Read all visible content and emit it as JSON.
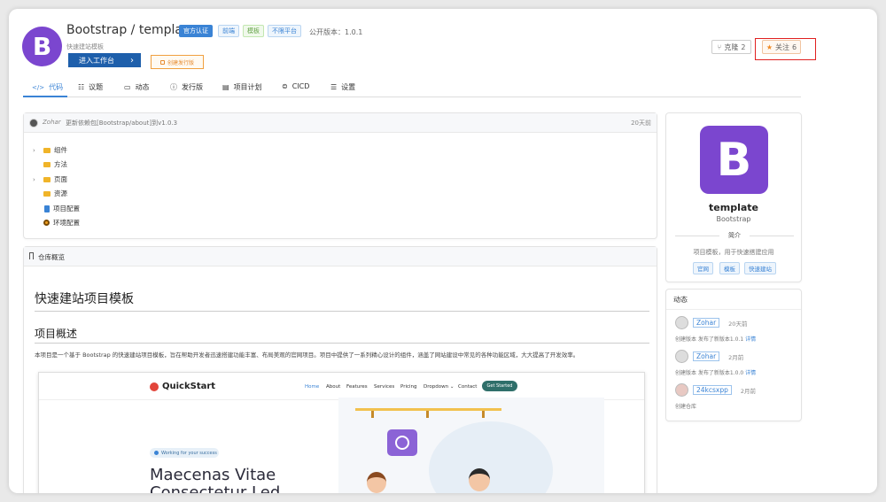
{
  "header": {
    "repo_title": "Bootstrap / template",
    "tags": [
      "官方认证",
      "前端",
      "模板",
      "不限平台"
    ],
    "version": "公开版本：1.0.1",
    "subtitle": "快速建站模板",
    "workbench_label": "进入工作台",
    "release_label": "创建发行版",
    "fork_label": "克隆",
    "fork_count": "2",
    "follow_label": "关注",
    "follow_count": "6",
    "logo_letter": "B"
  },
  "tabs": [
    {
      "label": "代码",
      "icon": "code-icon"
    },
    {
      "label": "议题",
      "icon": "issues-icon"
    },
    {
      "label": "动态",
      "icon": "activity-icon"
    },
    {
      "label": "发行版",
      "icon": "release-icon"
    },
    {
      "label": "项目计划",
      "icon": "plan-icon"
    },
    {
      "label": "CICD",
      "icon": "cicd-icon"
    },
    {
      "label": "设置",
      "icon": "settings-icon"
    }
  ],
  "commit": {
    "author": "Zohar",
    "message": "更新依赖包[Bootstrap/about]到v1.0.3",
    "time": "20天前"
  },
  "tree": [
    {
      "name": "组件",
      "type": "folder",
      "expandable": true
    },
    {
      "name": "方法",
      "type": "folder",
      "expandable": false
    },
    {
      "name": "页面",
      "type": "folder",
      "expandable": true
    },
    {
      "name": "资源",
      "type": "folder",
      "expandable": false
    },
    {
      "name": "项目配置",
      "type": "file",
      "expandable": false
    },
    {
      "name": "环境配置",
      "type": "config",
      "expandable": false
    }
  ],
  "readme": {
    "header": "仓库概览",
    "h1": "快速建站项目模板",
    "h2": "项目概述",
    "paragraph": "本项目是一个基于 Bootstrap 的快速建站项目模板，旨在帮助开发者迅速搭建功能丰富、布局美观的官网项目。项目中提供了一系列精心设计的组件，涵盖了网站建设中常见的各种功能区域，大大提高了开发效率。",
    "preview": {
      "brand": "QuickStart",
      "nav": [
        "Home",
        "About",
        "Features",
        "Services",
        "Pricing",
        "Dropdown ⌄",
        "Contact"
      ],
      "cta": "Get Started",
      "pill": "Working for your success",
      "hero_line1": "Maecenas Vitae",
      "hero_line2": "Consectetur Led"
    }
  },
  "side": {
    "logo_letter": "B",
    "name": "template",
    "org": "Bootstrap",
    "intro_label": "简介",
    "intro_text": "项目模板，用于快速搭建应用",
    "tags": [
      "官网",
      "模板",
      "快速建站"
    ]
  },
  "activity": {
    "title": "动态",
    "items": [
      {
        "user": "Zohar",
        "time": "20天前",
        "desc": "创建版本 发布了新版本1.0.1",
        "link": "详情"
      },
      {
        "user": "Zohar",
        "time": "2月前",
        "desc": "创建版本 发布了新版本1.0.0",
        "link": "详情"
      },
      {
        "user": "24kcsxpp",
        "time": "2月前",
        "desc": "创建仓库",
        "link": ""
      }
    ]
  },
  "colors": {
    "brand_purple": "#7b46cf",
    "accent_blue": "#3a83d5",
    "highlight_red": "#e02020"
  }
}
